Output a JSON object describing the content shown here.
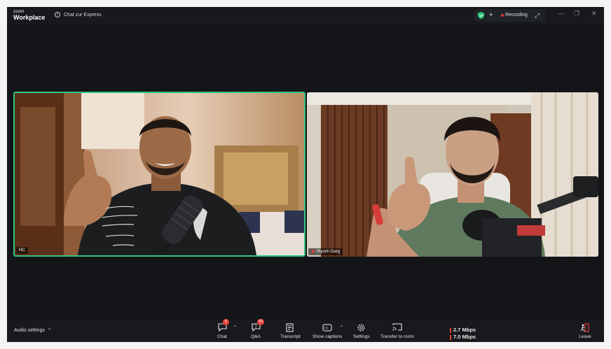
{
  "app": {
    "brand_top": "zoom",
    "brand_bottom": "Workplace"
  },
  "titlebar": {
    "chat_link": "Chat zur Express",
    "recording_label": "Recording"
  },
  "participants": [
    {
      "name": "HC",
      "active_speaker": true
    },
    {
      "name": "Piyush Garg",
      "muted": true
    }
  ],
  "toolbar": {
    "audio_settings": "Audio settings",
    "chat": {
      "label": "Chat",
      "badge": "5"
    },
    "qa": {
      "label": "Q&A",
      "badge": "60"
    },
    "transcript": {
      "label": "Transcript"
    },
    "captions": {
      "label": "Show captions"
    },
    "settings": {
      "label": "Settings"
    },
    "transfer": {
      "label": "Transfer to room"
    },
    "network": {
      "up": "2.7 Mbps",
      "down": "7.0 Mbps"
    },
    "leave": {
      "label": "Leave"
    }
  },
  "colors": {
    "active_border": "#2fc67f",
    "badge": "#e5403a",
    "leave": "#e5403a",
    "record_dot": "#e53935"
  }
}
